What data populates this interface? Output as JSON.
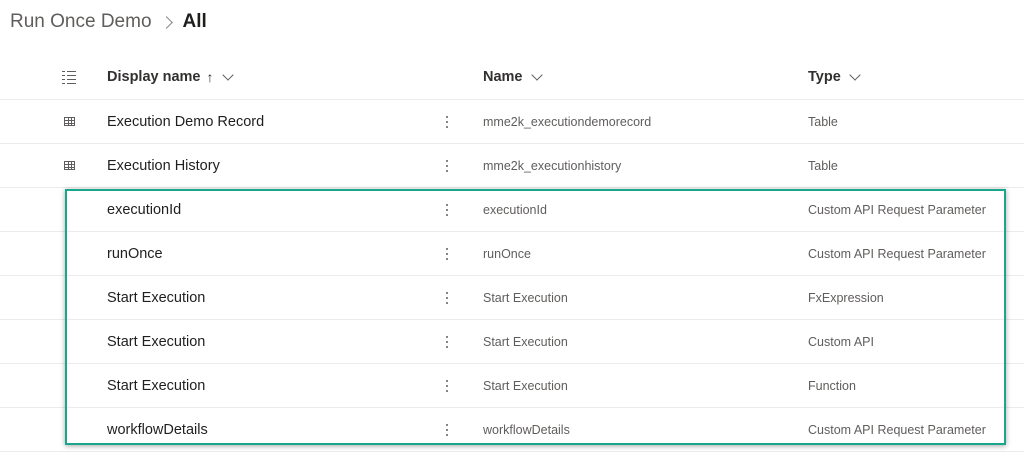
{
  "breadcrumb": {
    "parent": "Run Once Demo",
    "current": "All"
  },
  "columns": {
    "display_name": "Display name",
    "sort_arrow": "↑",
    "name": "Name",
    "type": "Type"
  },
  "rows": [
    {
      "display_name": "Execution Demo Record",
      "name": "mme2k_executiondemorecord",
      "type": "Table",
      "icon": "table-icon"
    },
    {
      "display_name": "Execution History",
      "name": "mme2k_executionhistory",
      "type": "Table",
      "icon": "table-icon"
    },
    {
      "display_name": "executionId",
      "name": "executionId",
      "type": "Custom API Request Parameter"
    },
    {
      "display_name": "runOnce",
      "name": "runOnce",
      "type": "Custom API Request Parameter"
    },
    {
      "display_name": "Start Execution",
      "name": "Start Execution",
      "type": "FxExpression"
    },
    {
      "display_name": "Start Execution",
      "name": "Start Execution",
      "type": "Custom API"
    },
    {
      "display_name": "Start Execution",
      "name": "Start Execution",
      "type": "Function"
    },
    {
      "display_name": "workflowDetails",
      "name": "workflowDetails",
      "type": "Custom API Request Parameter"
    }
  ],
  "colors": {
    "highlight_border": "#1aa68a",
    "row_divider": "#edebe9"
  }
}
